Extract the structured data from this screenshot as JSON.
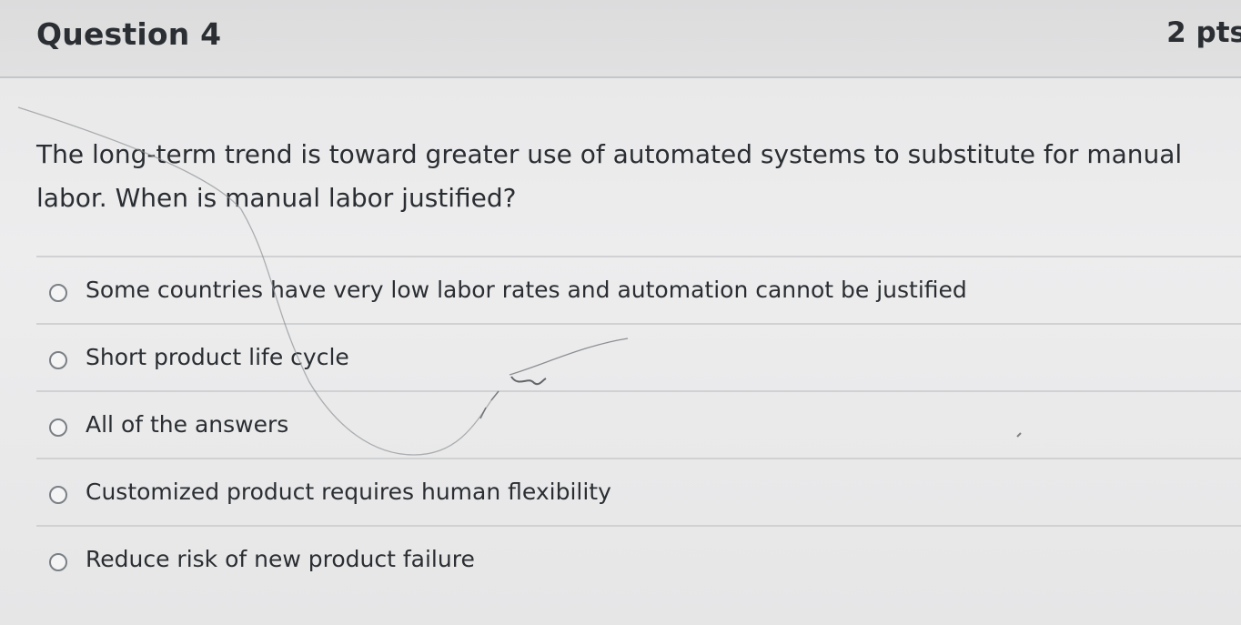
{
  "question": {
    "title": "Question 4",
    "points": "2 pts",
    "text": "The long-term trend is toward greater use of automated systems to substitute for manual labor. When is manual labor justified?"
  },
  "answers": [
    {
      "label": "Some countries have very low labor rates and automation cannot be justified"
    },
    {
      "label": "Short product life cycle"
    },
    {
      "label": "All of the answers"
    },
    {
      "label": "Customized product requires human flexibility"
    },
    {
      "label": "Reduce risk of new product failure"
    }
  ],
  "colors": {
    "background": "#e9e9ea",
    "text": "#2a2e32",
    "divider": "#cfd1d3"
  }
}
